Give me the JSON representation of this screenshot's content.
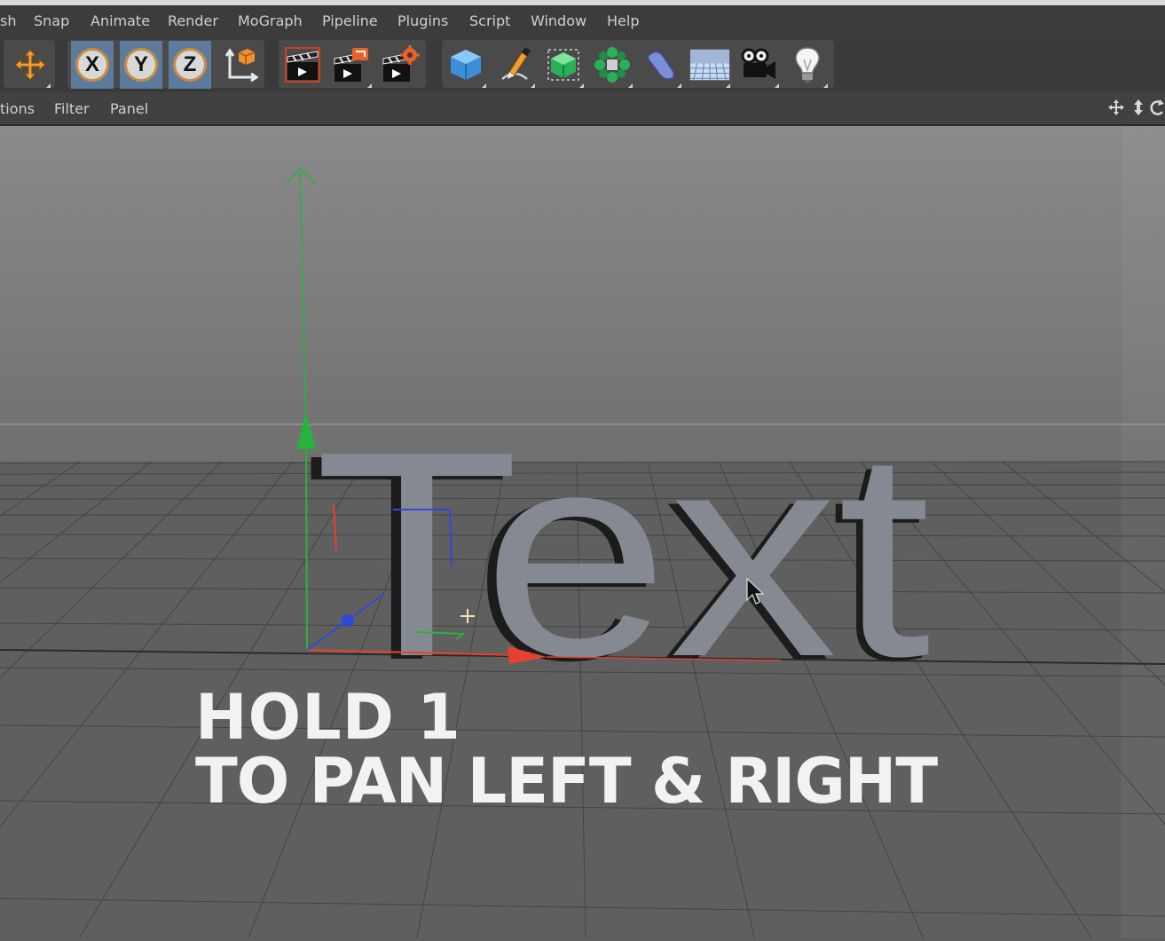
{
  "menubar": {
    "items": [
      "sh",
      "Snap",
      "Animate",
      "Render",
      "MoGraph",
      "Pipeline",
      "Plugins",
      "Script",
      "Window",
      "Help"
    ]
  },
  "toolbar": {
    "axis_x": "X",
    "axis_y": "Y",
    "axis_z": "Z",
    "selected_color": "#5d7b9d",
    "icons": [
      "move-icon",
      "lock-x-icon",
      "lock-y-icon",
      "lock-z-icon",
      "coordinate-system-icon",
      "render-view-icon",
      "render-to-picture-viewer-icon",
      "render-settings-icon",
      "cube-icon",
      "pen-icon",
      "subdivision-surface-icon",
      "cloner-icon",
      "bend-deformer-icon",
      "floor-icon",
      "camera-icon",
      "light-icon"
    ]
  },
  "viewport_menu": {
    "items": [
      "tions",
      "Filter",
      "Panel"
    ]
  },
  "viewport": {
    "object_text": "Text",
    "caption_line1": "HOLD 1",
    "caption_line2": "TO PAN LEFT & RIGHT",
    "axis_colors": {
      "x": "#e8402e",
      "y": "#27b33b",
      "z": "#2f49d8"
    }
  }
}
